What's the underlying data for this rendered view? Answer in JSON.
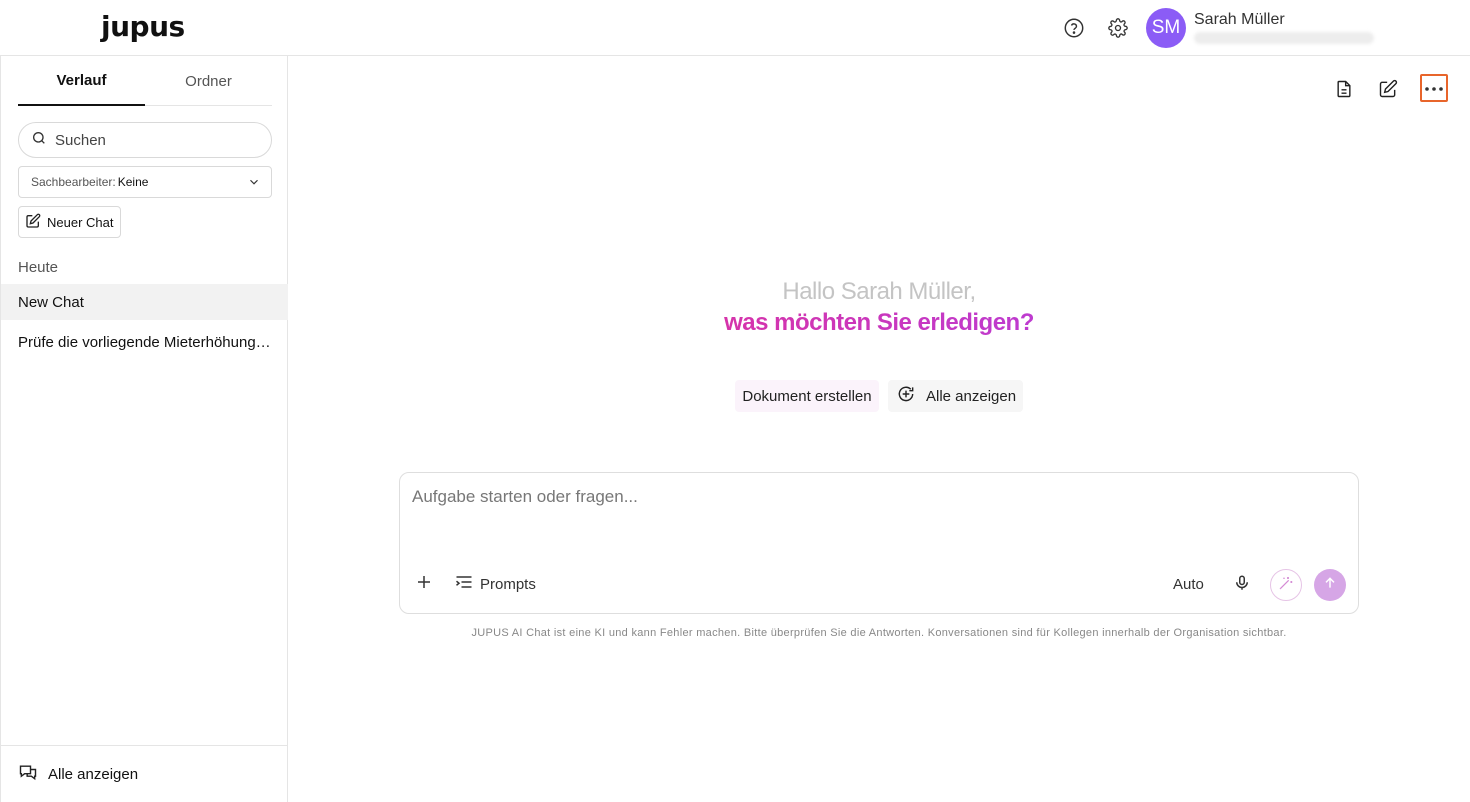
{
  "header": {
    "logo": "jupus",
    "help_icon": "help-circle-icon",
    "settings_icon": "gear-icon",
    "user": {
      "initials": "SM",
      "name": "Sarah Müller",
      "avatar_color": "#8b5cf6"
    }
  },
  "sidebar": {
    "tabs": [
      {
        "label": "Verlauf",
        "active": true
      },
      {
        "label": "Ordner",
        "active": false
      }
    ],
    "search": {
      "placeholder": "Suchen"
    },
    "filter": {
      "label": "Sachbearbeiter:",
      "value": "Keine"
    },
    "new_chat_label": "Neuer Chat",
    "section": "Heute",
    "chats": [
      {
        "title": "New Chat",
        "active": true
      },
      {
        "title": "Prüfe die vorliegende Mieterhöhung auf formelle und materielle Wirksamkeit",
        "active": false
      }
    ],
    "footer_label": "Alle anzeigen"
  },
  "main": {
    "greeting_line1": "Hallo Sarah Müller,",
    "greeting_line2": "was möchten Sie erledigen?",
    "chips": [
      "Dokument erstellen",
      "Alle anzeigen"
    ],
    "composer": {
      "placeholder": "Aufgabe starten oder fragen...",
      "prompts_label": "Prompts",
      "mode_label": "Auto"
    },
    "disclaimer": "JUPUS AI Chat ist eine KI und kann Fehler machen. Bitte überprüfen Sie die Antworten. Konversationen sind für Kollegen innerhalb der Organisation sichtbar."
  },
  "colors": {
    "accent_pink": "#e0309a",
    "accent_purple": "#b33ee0",
    "focus_orange": "#e8652b",
    "send_button": "#d6a6e6"
  }
}
